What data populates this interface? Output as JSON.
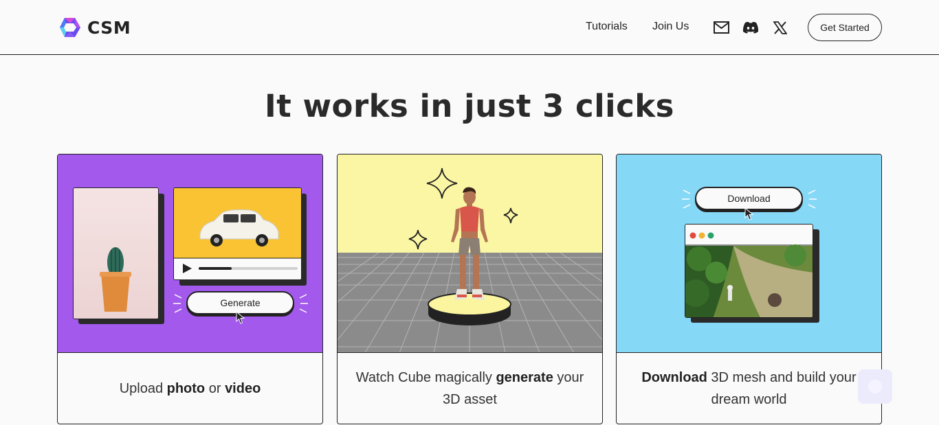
{
  "header": {
    "logo_text": "CSM",
    "nav": [
      {
        "label": "Tutorials"
      },
      {
        "label": "Join Us"
      }
    ],
    "icons": [
      "mail-icon",
      "discord-icon",
      "x-icon"
    ],
    "cta_label": "Get Started"
  },
  "main": {
    "headline": "It works in just 3 clicks",
    "cards": [
      {
        "caption_parts": [
          "Upload ",
          "photo",
          " or ",
          "video"
        ],
        "art_button_label": "Generate",
        "bg_color": "#a259ec"
      },
      {
        "caption_parts": [
          "Watch Cube magically ",
          "generate",
          " your 3D asset"
        ],
        "bg_color": "#fbf6a4"
      },
      {
        "caption_parts": [
          "Download",
          " 3D mesh and build your dream world"
        ],
        "art_button_label": "Download",
        "bg_color": "#86d8f7"
      }
    ]
  },
  "colors": {
    "purple": "#a259ec",
    "yellow": "#fbf6a4",
    "sky": "#86d8f7",
    "ink": "#222222"
  }
}
